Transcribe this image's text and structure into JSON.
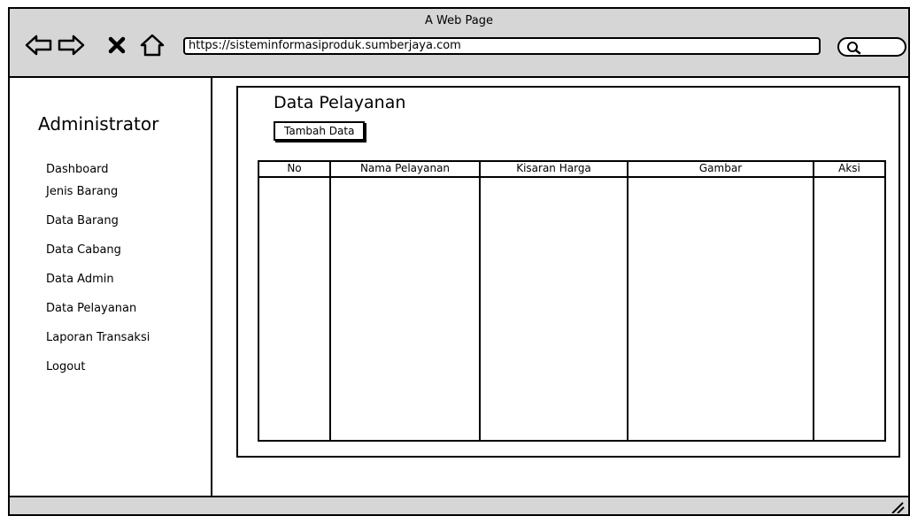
{
  "window": {
    "title": "A Web Page"
  },
  "browser": {
    "url": "https://sisteminformasiproduk.sumberjaya.com",
    "icons": [
      "back-arrow-icon",
      "forward-arrow-icon",
      "close-icon",
      "home-icon",
      "search-icon"
    ]
  },
  "sidebar": {
    "title": "Administrator",
    "items": [
      {
        "label": "Dashboard"
      },
      {
        "label": "Jenis Barang"
      },
      {
        "label": "Data Barang"
      },
      {
        "label": "Data Cabang"
      },
      {
        "label": "Data Admin"
      },
      {
        "label": "Data Pelayanan"
      },
      {
        "label": "Laporan Transaksi"
      },
      {
        "label": "Logout"
      }
    ]
  },
  "main": {
    "title": "Data Pelayanan",
    "add_button": "Tambah Data",
    "table": {
      "columns": [
        "No",
        "Nama Pelayanan",
        "Kisaran Harga",
        "Gambar",
        "Aksi"
      ],
      "rows": []
    }
  }
}
